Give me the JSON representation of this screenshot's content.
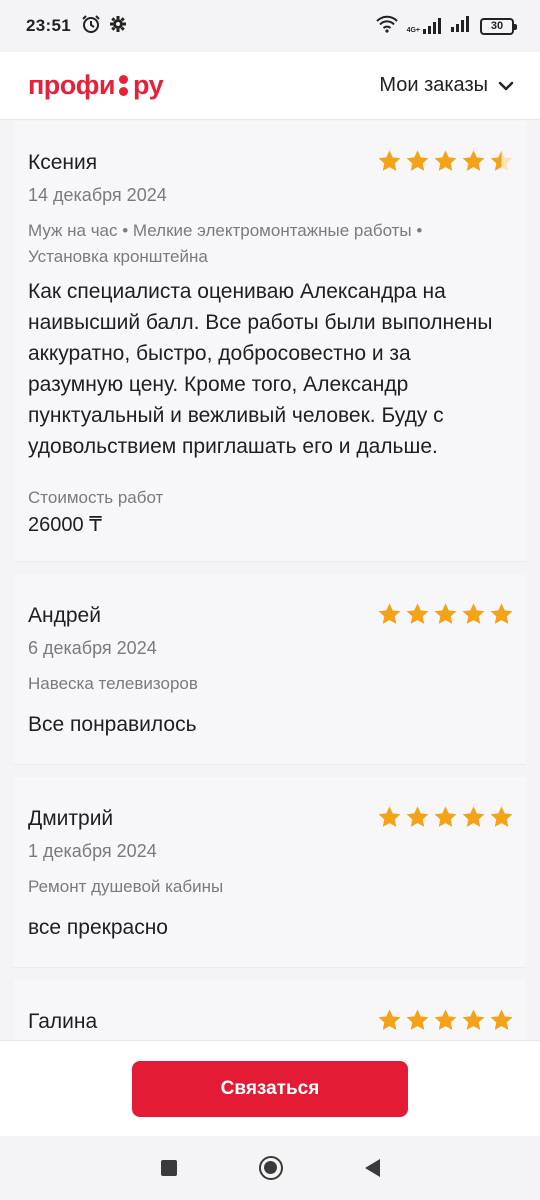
{
  "status_bar": {
    "time": "23:51",
    "network_label_top": "4G+",
    "network_label_bottom": "ıl",
    "battery": "30"
  },
  "header": {
    "logo_text_left": "профи",
    "logo_text_right": "ру",
    "orders_label": "Мои заказы"
  },
  "colors": {
    "brand": "#e8203a",
    "star": "#f5a21b",
    "button": "#e31b35"
  },
  "reviews": [
    {
      "name": "Ксения",
      "rating": 4.5,
      "date": "14 декабря 2024",
      "tags": "Муж на час • Мелкие электромонтажные работы • Установка кронштейна",
      "text": "Как специалиста оцениваю Александра на наивысший балл. Все работы были выполнены аккуратно, быстро, добросовестно и за разумную цену. Кроме того, Александр пунктуальный и вежливый человек. Буду с удовольствием приглашать его и дальше.",
      "cost_label": "Стоимость работ",
      "cost_value": "26000 ₸"
    },
    {
      "name": "Андрей",
      "rating": 5,
      "date": "6 декабря 2024",
      "tags": "Навеска телевизоров",
      "text": "Все понравилось"
    },
    {
      "name": "Дмитрий",
      "rating": 5,
      "date": "1 декабря 2024",
      "tags": "Ремонт душевой кабины",
      "text": "все прекрасно"
    },
    {
      "name": "Галина",
      "rating": 5
    }
  ],
  "action": {
    "contact_label": "Связаться"
  }
}
